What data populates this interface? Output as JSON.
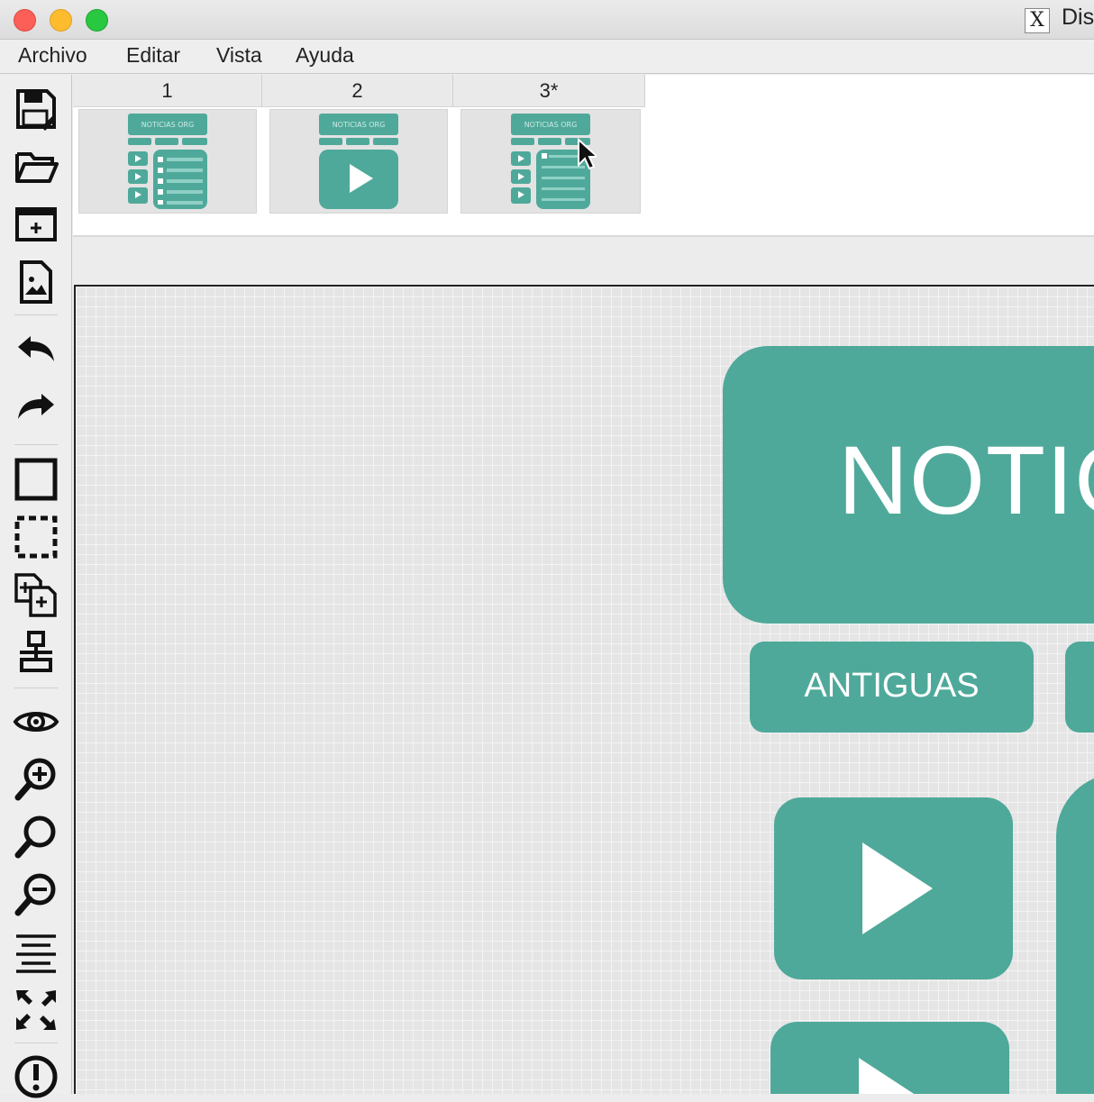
{
  "window": {
    "title": "Dis"
  },
  "menu": {
    "items": [
      "Archivo",
      "Editar",
      "Vista",
      "Ayuda"
    ]
  },
  "pages": {
    "tabs": [
      {
        "label": "1"
      },
      {
        "label": "2"
      },
      {
        "label": "3*"
      }
    ],
    "thumb_header_text": "NOTICIAS ORG"
  },
  "canvas": {
    "banner_text": "NOTIC",
    "button_antiguas": "ANTIGUAS"
  },
  "colors": {
    "accent_teal": "#4fa99a"
  },
  "toolbar": {
    "tools": [
      "save-icon",
      "open-folder-icon",
      "new-page-icon",
      "image-icon",
      "undo-icon",
      "redo-icon",
      "rectangle-icon",
      "selection-icon",
      "copy-icon",
      "align-icon",
      "preview-eye-icon",
      "zoom-in-icon",
      "zoom-reset-icon",
      "zoom-out-icon",
      "text-align-icon",
      "fullscreen-icon",
      "alert-icon"
    ]
  }
}
